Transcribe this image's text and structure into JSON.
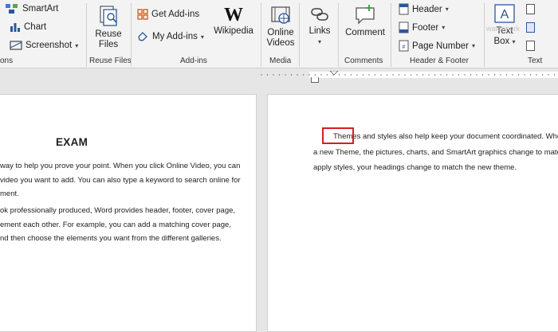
{
  "ribbon": {
    "illustrations": {
      "smartart_label": "SmartArt",
      "chart_label": "Chart",
      "screenshot_label": "Screenshot",
      "group_label_fragment": "ons"
    },
    "reuse_files": {
      "button_label_line1": "Reuse",
      "button_label_line2": "Files",
      "group_label": "Reuse Files"
    },
    "addins": {
      "get_addins_label": "Get Add-ins",
      "my_addins_label": "My Add-ins",
      "wikipedia_label": "Wikipedia",
      "group_label": "Add-ins"
    },
    "media": {
      "online_videos_line1": "Online",
      "online_videos_line2": "Videos",
      "group_label": "Media"
    },
    "links": {
      "links_label": "Links"
    },
    "comments": {
      "comment_label": "Comment",
      "group_label": "Comments"
    },
    "header_footer": {
      "header_label": "Header",
      "footer_label": "Footer",
      "page_number_label": "Page Number",
      "group_label": "Header & Footer"
    },
    "text": {
      "textbox_line1": "Text",
      "textbox_line2": "Box",
      "group_label": "Text",
      "watermark_fragment": "watermark"
    }
  },
  "document": {
    "left_page": {
      "title": "EXAM",
      "lines": [
        "way to help you prove your point. When you click Online Video, you can",
        "video you want to add. You can also type a keyword to search online for",
        "ment.",
        "ok professionally produced, Word provides header, footer, cover page,",
        "ement each other. For example, you can add a matching cover page,",
        "nd then choose the elements you want from the different galleries."
      ]
    },
    "right_page": {
      "lines": [
        "Themes and styles also help keep your document coordinated. When you",
        "a new Theme, the pictures, charts, and SmartArt graphics change to match you",
        "apply styles, your headings change to match the new theme."
      ]
    }
  },
  "colors": {
    "accent_blue": "#2b579a",
    "highlight_red": "#d21f26",
    "ribbon_bg": "#f3f3f3"
  }
}
